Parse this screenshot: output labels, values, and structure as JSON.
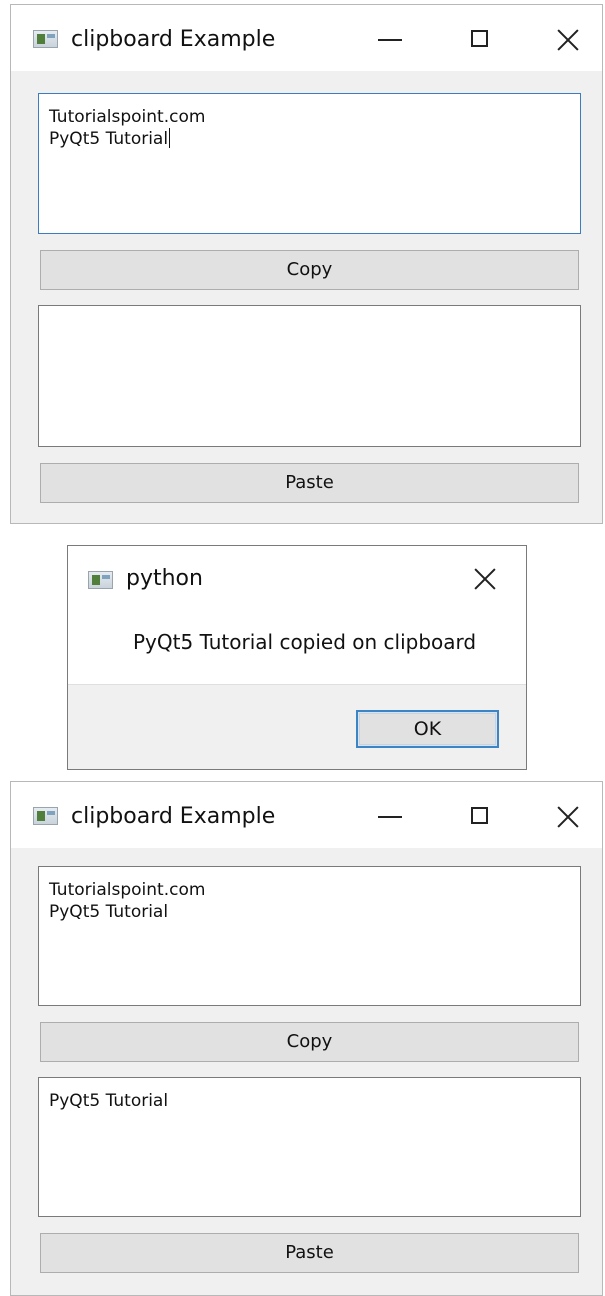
{
  "window_before": {
    "title": "clipboard Example",
    "source_text": "Tutorialspoint.com\nPyQt5 Tutorial",
    "copy_label": "Copy",
    "target_text": "",
    "paste_label": "Paste"
  },
  "dialog": {
    "title": "python",
    "message": "PyQt5 Tutorial copied on clipboard",
    "ok_label": "OK"
  },
  "window_after": {
    "title": "clipboard Example",
    "source_text": "Tutorialspoint.com\nPyQt5 Tutorial",
    "copy_label": "Copy",
    "target_text": "PyQt5 Tutorial",
    "paste_label": "Paste"
  },
  "icons": {
    "app": "qt-app-icon",
    "minimize": "minimize-icon",
    "maximize": "maximize-icon",
    "close": "close-icon"
  },
  "colors": {
    "focus_border": "#3b7dbf",
    "window_bg": "#f0f0f0",
    "button_bg": "#e1e1e1"
  }
}
